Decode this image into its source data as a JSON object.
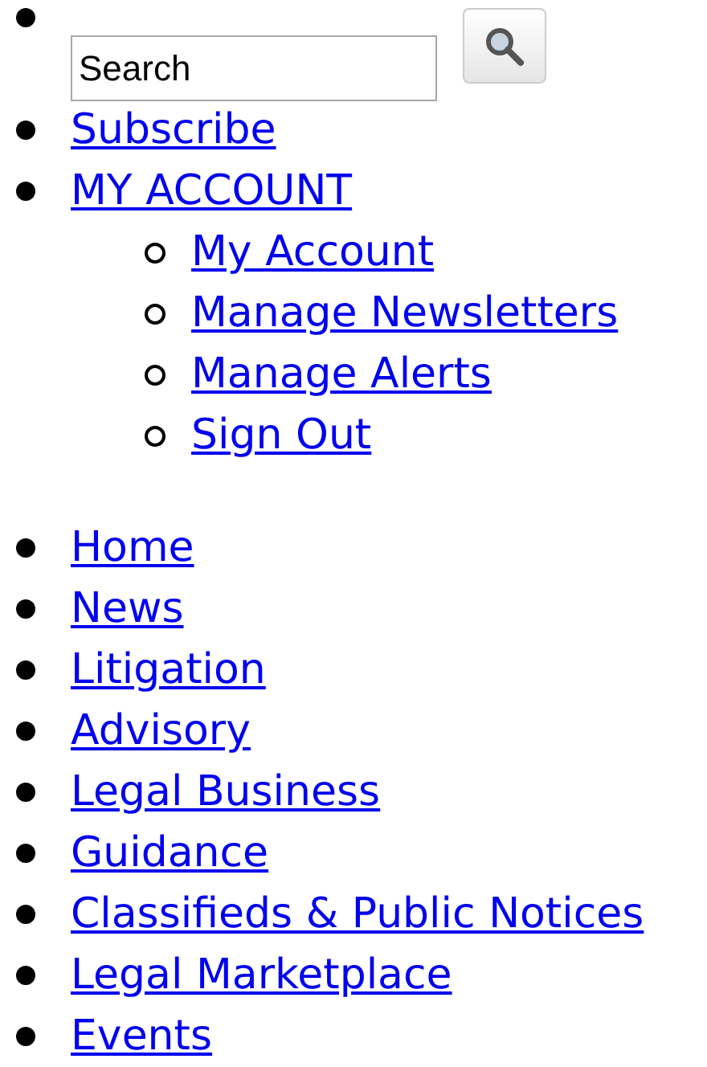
{
  "search": {
    "value": "Search"
  },
  "top_nav": [
    {
      "label": "Subscribe"
    },
    {
      "label": "MY ACCOUNT",
      "children": [
        {
          "label": "My Account"
        },
        {
          "label": "Manage Newsletters"
        },
        {
          "label": "Manage Alerts"
        },
        {
          "label": "Sign Out"
        }
      ]
    }
  ],
  "main_nav": [
    {
      "label": "Home"
    },
    {
      "label": "News"
    },
    {
      "label": "Litigation"
    },
    {
      "label": "Advisory"
    },
    {
      "label": "Legal Business"
    },
    {
      "label": "Guidance"
    },
    {
      "label": "Classifieds & Public Notices"
    },
    {
      "label": "Legal Marketplace"
    },
    {
      "label": "Events"
    }
  ]
}
